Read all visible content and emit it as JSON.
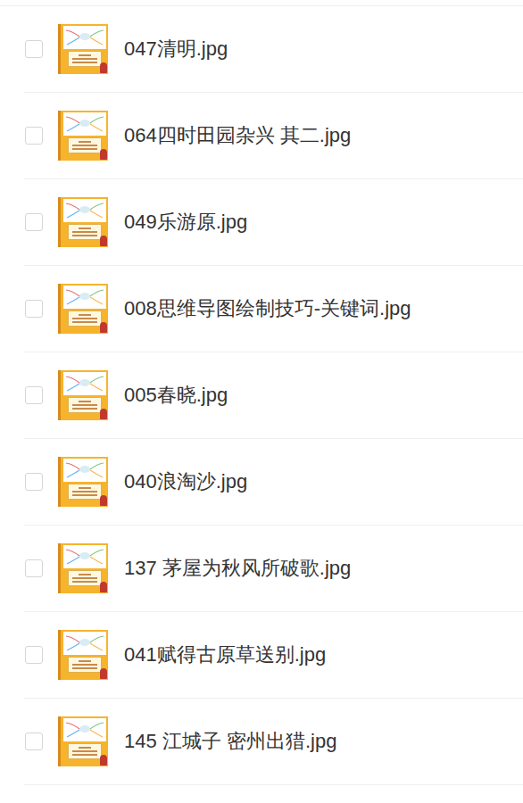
{
  "files": [
    {
      "name": "047清明.jpg",
      "checked": false
    },
    {
      "name": "064四时田园杂兴 其二.jpg",
      "checked": false
    },
    {
      "name": "049乐游原.jpg",
      "checked": false
    },
    {
      "name": "008思维导图绘制技巧-关键词.jpg",
      "checked": false
    },
    {
      "name": "005春晓.jpg",
      "checked": false
    },
    {
      "name": "040浪淘沙.jpg",
      "checked": false
    },
    {
      "name": "137 茅屋为秋风所破歌.jpg",
      "checked": false
    },
    {
      "name": "041赋得古原草送别.jpg",
      "checked": false
    },
    {
      "name": "145 江城子 密州出猎.jpg",
      "checked": false
    }
  ]
}
